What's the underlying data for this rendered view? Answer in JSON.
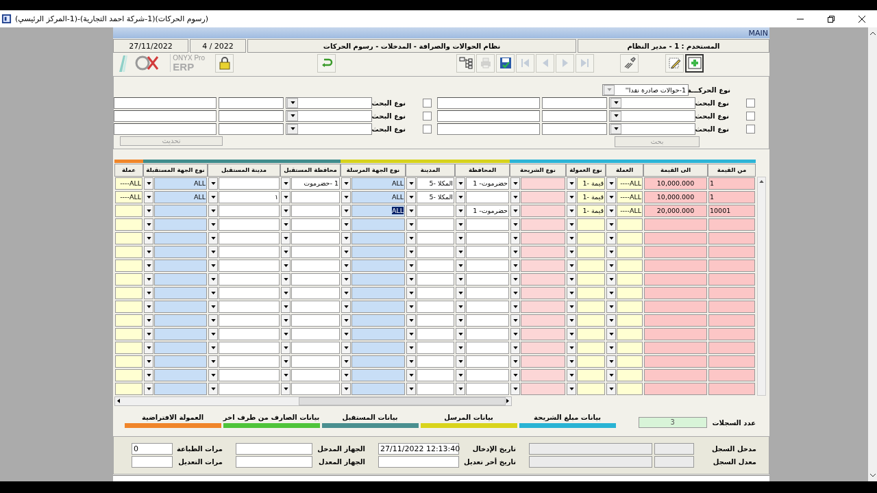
{
  "window": {
    "title": "(رسوم الحركات)(1-شركة احمد التجارية)-(1-المركز الرئيسي)"
  },
  "form": {
    "name": "MAIN",
    "user": "المستخدم : 1 - مدير النظام",
    "title": "نظام الحوالات والصرافة - المدخلات - رسوم الحركات",
    "period": "2022 / 4",
    "date": "27/11/2022"
  },
  "logo": {
    "line1": "ONYX Pro",
    "line2": "ERP"
  },
  "toolbar": [
    {
      "buttons": [
        {
          "kind": "add",
          "disabled": false,
          "selected": true
        },
        {
          "kind": "edit",
          "disabled": false,
          "selected": false
        }
      ]
    },
    {
      "buttons": [
        {
          "kind": "brush",
          "disabled": false,
          "selected": false
        }
      ]
    },
    {
      "buttons": [
        {
          "kind": "last",
          "disabled": true,
          "selected": false
        },
        {
          "kind": "next",
          "disabled": true,
          "selected": false
        },
        {
          "kind": "prev",
          "disabled": true,
          "selected": false
        },
        {
          "kind": "first",
          "disabled": true,
          "selected": false
        },
        {
          "kind": "save",
          "disabled": false,
          "selected": false
        },
        {
          "kind": "print",
          "disabled": true,
          "selected": false
        },
        {
          "kind": "tree",
          "disabled": false,
          "selected": false
        }
      ]
    },
    {
      "buttons": [
        {
          "kind": "undo",
          "disabled": false,
          "selected": false
        }
      ]
    },
    {
      "buttons": [
        {
          "kind": "lock",
          "disabled": false,
          "selected": false
        }
      ]
    }
  ],
  "search": {
    "type_label": "نوع الحركـــة",
    "type_value": "1-حوالات صادرة نقدا''",
    "right_rows": [
      {
        "label": "نوع البحث",
        "checked": false
      },
      {
        "label": "نوع البحث",
        "checked": false
      },
      {
        "label": "نوع البحث",
        "checked": false
      }
    ],
    "left_rows": [
      {
        "label": "نوع البحث",
        "checked": false
      },
      {
        "label": "نوع البحث",
        "checked": false
      },
      {
        "label": "نوع البحث",
        "checked": false
      }
    ],
    "search_button": {
      "label": "بحث",
      "disabled": true
    },
    "refresh_button": {
      "label": "تحديث",
      "disabled": true
    }
  },
  "grid": {
    "groups": [
      {
        "color": "#2cb4d6",
        "columns": [
          {
            "label": "من القيمة",
            "kind": "text",
            "color": "#fcc6c6"
          },
          {
            "label": "الى القيمة",
            "kind": "text",
            "color": "#fcc6c6"
          },
          {
            "label": "العملة",
            "kind": "combo",
            "color": "#ffffd2"
          },
          {
            "label": "نوع العمولة",
            "kind": "combo",
            "color": "#ffffd2"
          },
          {
            "label": "نوع الشريحة",
            "kind": "combo",
            "color": "#fcd6d6"
          }
        ]
      },
      {
        "color": "#d6d21c",
        "columns": [
          {
            "label": "المحافظة",
            "kind": "combo",
            "color": "#ffffff"
          },
          {
            "label": "المدينة",
            "kind": "combo",
            "color": "#ffffff"
          },
          {
            "label": "نوع الجهة المرسلة",
            "kind": "combo",
            "color": "#c8def6"
          }
        ]
      },
      {
        "color": "#3f8c8c",
        "columns": [
          {
            "label": "محافظة المستقبل",
            "kind": "combo",
            "color": "#ffffff"
          },
          {
            "label": "مدينة المستقبل",
            "kind": "combo",
            "color": "#ffffff"
          },
          {
            "label": "نوع الجهة المستقبلة",
            "kind": "combo",
            "color": "#c8def6"
          }
        ]
      },
      {
        "color": "#f0862a",
        "columns": [
          {
            "label": "عملة",
            "kind": "text",
            "color": "#ffffd2"
          }
        ]
      }
    ],
    "rows": [
      {
        "cells": [
          {
            "text": "1",
            "selected": false
          },
          {
            "text": "10,000.000",
            "selected": false
          },
          {
            "text": "ALL----",
            "selected": false
          },
          {
            "text": "قيمة -1",
            "selected": false
          },
          null,
          {
            "text": "حضرموت- 1",
            "selected": false
          },
          {
            "text": "المكلا -5",
            "selected": false
          },
          {
            "text": "ALL",
            "selected": false
          },
          {
            "text": "1 -حضرموت",
            "selected": false
          },
          null,
          {
            "text": "ALL",
            "selected": false
          },
          {
            "text": "ALL----",
            "selected": false
          }
        ]
      },
      {
        "cells": [
          {
            "text": "1",
            "selected": false
          },
          {
            "text": "10,000.000",
            "selected": false
          },
          {
            "text": "ALL----",
            "selected": false
          },
          {
            "text": "قيمة -1",
            "selected": false
          },
          null,
          null,
          {
            "text": "المكلا -5",
            "selected": false
          },
          {
            "text": "ALL",
            "selected": false
          },
          null,
          {
            "text": "١",
            "selected": false
          },
          {
            "text": "ALL",
            "selected": false
          },
          {
            "text": "ALL----",
            "selected": false
          }
        ]
      },
      {
        "cells": [
          {
            "text": "10001",
            "selected": false
          },
          {
            "text": "20,000.000",
            "selected": false
          },
          {
            "text": "ALL----",
            "selected": false
          },
          {
            "text": "قيمة -1",
            "selected": false
          },
          null,
          {
            "text": "حضرموت- 1",
            "selected": false
          },
          null,
          {
            "text": "ALL",
            "selected": true
          },
          null,
          null,
          null,
          null
        ]
      }
    ]
  },
  "legend": {
    "count_label": "عدد السجلات",
    "count": "3",
    "items": [
      {
        "label": "بيانات مبلغ الشريحة",
        "color": "#29b3d4"
      },
      {
        "label": "بيانات المرسل",
        "color": "#d9d41c"
      },
      {
        "label": "بيانات المستقبل",
        "color": "#4a8f8f"
      },
      {
        "label": "بيانات الصارف من طرف اخر",
        "color": "#4fc43a"
      },
      {
        "label": "العمولة الافتراضية",
        "color": "#f0852a"
      }
    ]
  },
  "record": {
    "rows": [
      [
        {
          "label": "مدخل السجل"
        },
        {
          "label": "تاريخ الإدخال",
          "value": "27/11/2022 12:13:40"
        },
        {
          "label": "الجهاز المدخل"
        },
        {
          "label": "مرات الطباعة",
          "value": "0"
        }
      ],
      [
        {
          "label": "معدل السجل"
        },
        {
          "label": "تاريخ أخر تعديل"
        },
        {
          "label": "الجهاز المعدل"
        },
        {
          "label": "مرات التعديل"
        }
      ]
    ]
  }
}
